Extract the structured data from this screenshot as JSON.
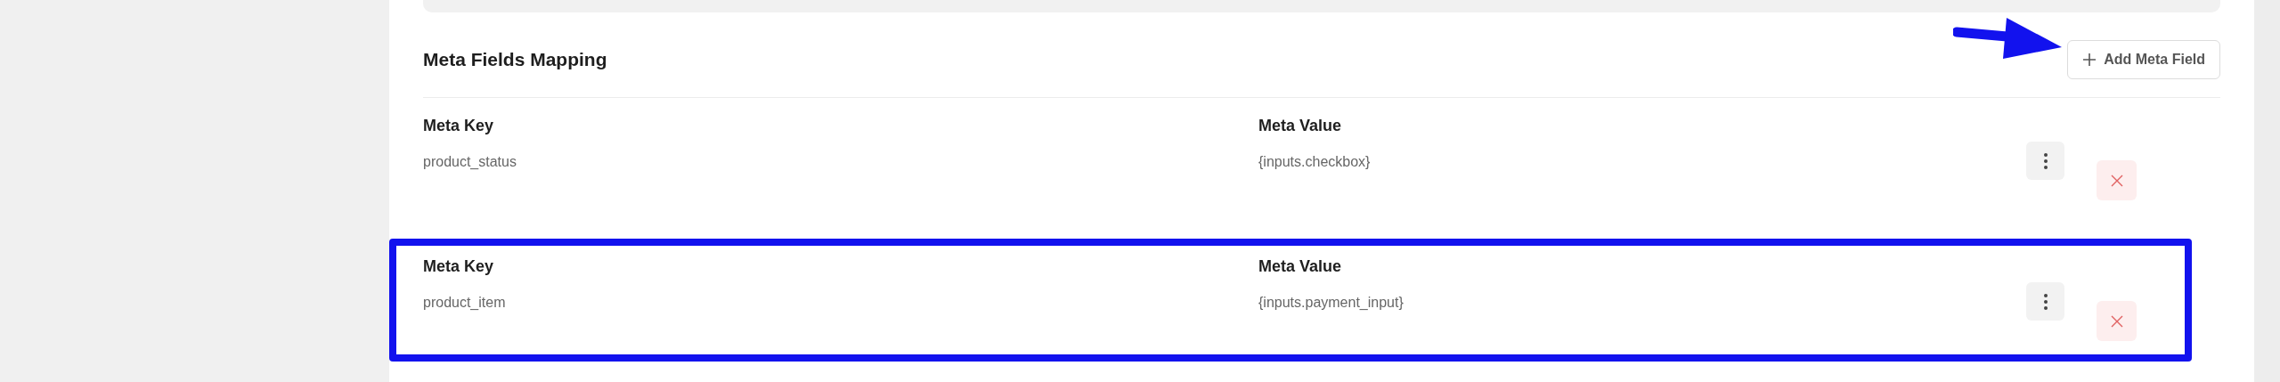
{
  "section": {
    "title": "Meta Fields Mapping",
    "add_button": {
      "label": "Add Meta Field"
    }
  },
  "mappings": [
    {
      "key_label": "Meta Key",
      "key": "product_status",
      "value_label": "Meta Value",
      "value": "{inputs.checkbox}",
      "highlighted": false
    },
    {
      "key_label": "Meta Key",
      "key": "product_item",
      "value_label": "Meta Value",
      "value": "{inputs.payment_input}",
      "highlighted": true
    }
  ]
}
